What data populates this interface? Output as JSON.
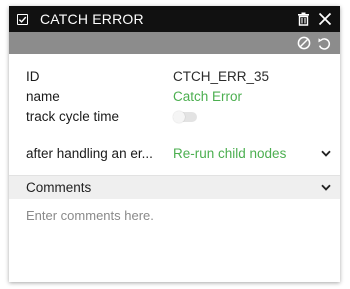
{
  "titlebar": {
    "title": "CATCH ERROR",
    "icons": [
      "checkbox-icon",
      "trash-icon",
      "close-icon"
    ]
  },
  "toolbar": {
    "icons": [
      "disable-icon",
      "undo-icon"
    ]
  },
  "properties": {
    "id_label": "ID",
    "id_value": "CTCH_ERR_35",
    "name_label": "name",
    "name_value": "Catch Error",
    "track_label": "track cycle time",
    "track_enabled": false
  },
  "after_handling": {
    "label": "after handling an er...",
    "value": "Re-run child nodes"
  },
  "comments": {
    "header": "Comments",
    "placeholder": "Enter comments here."
  },
  "colors": {
    "titlebar_bg": "#111111",
    "toolbar_bg": "#8c8c8c",
    "accent_green": "#4caf50",
    "comments_header_bg": "#efefef"
  }
}
